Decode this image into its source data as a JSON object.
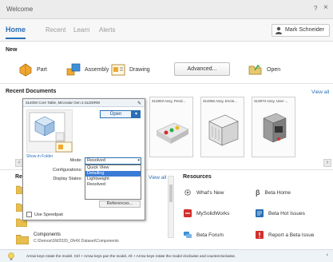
{
  "window": {
    "title": "Welcome",
    "help": "?",
    "close": "×"
  },
  "tabs": [
    {
      "label": "Home",
      "active": true
    },
    {
      "label": "Recent",
      "active": false
    },
    {
      "label": "Learn",
      "active": false
    },
    {
      "label": "Alerts",
      "active": false
    }
  ],
  "user": {
    "name": "Mark Schneider"
  },
  "new_section": {
    "title": "New",
    "part": "Part",
    "assembly": "Assembly",
    "drawing": "Drawing",
    "advanced": "Advanced...",
    "open": "Open"
  },
  "recent_documents": {
    "title": "Recent Documents",
    "view_all": "View all",
    "thumbs": [
      {
        "title": "314803 Assy, Pend..."
      },
      {
        "title": "314056 Assy, Enclo..."
      },
      {
        "title": "313973 Assy, User ..."
      }
    ],
    "prev_arrow": "‹",
    "next_arrow": "›"
  },
  "popup": {
    "header": "314000 Core Table, Microstar Gen 2.SLDDRW",
    "open_label": "Open",
    "show_in_folder": "Show in Folder",
    "mode_label": "Mode:",
    "mode_value": "Resolved",
    "configurations_label": "Configurations:",
    "display_states_label": "Display States:",
    "mode_options": [
      "Quick View",
      "Detailing",
      "Lightweight",
      "Resolved"
    ],
    "mode_options_highlight": 1,
    "references_label": "References...",
    "use_speedpak": "Use Speedpak"
  },
  "recent_folders": {
    "title_partial": "Re",
    "view_all": "View all"
  },
  "components": {
    "name": "Components",
    "path": "C:\\Demos\\SW2020_Oh4X Dataset\\Components"
  },
  "resources": {
    "title": "Resources",
    "items": [
      {
        "label": "What's New"
      },
      {
        "label": "Beta Home"
      },
      {
        "label": "MySolidWorks"
      },
      {
        "label": "Beta Hot Issues"
      },
      {
        "label": "Beta Forum"
      },
      {
        "label": "Report a Beta Issue"
      }
    ]
  },
  "status": {
    "text": "Arrow keys rotate the model. Ctrl + Arrow keys pan the model. Alt + Arrow keys rotate the model clockwise and counterclockwise.",
    "arrow": "‹"
  },
  "colors": {
    "accent": "#2a6fb5",
    "highlight": "#3a7bd5",
    "solidworks_red": "#d0312d"
  }
}
